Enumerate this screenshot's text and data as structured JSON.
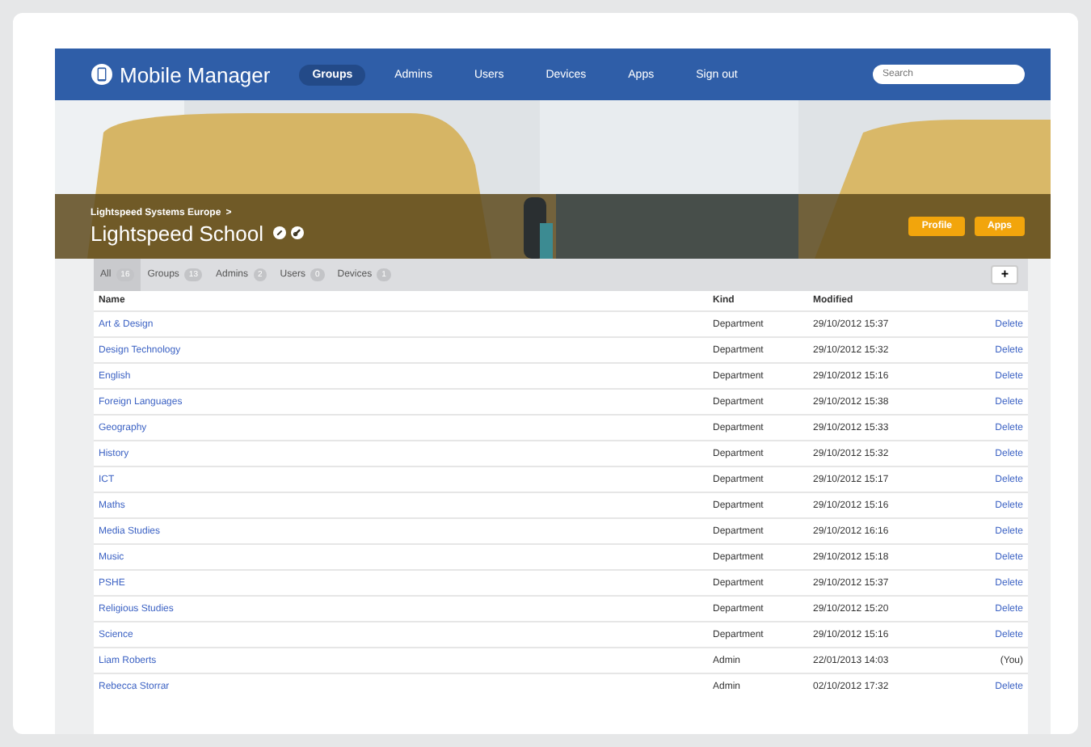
{
  "app": {
    "title": "Mobile Manager"
  },
  "nav": [
    {
      "label": "Groups",
      "selected": true
    },
    {
      "label": "Admins",
      "selected": false
    },
    {
      "label": "Users",
      "selected": false
    },
    {
      "label": "Devices",
      "selected": false
    },
    {
      "label": "Apps",
      "selected": false
    },
    {
      "label": "Sign out",
      "selected": false
    }
  ],
  "search": {
    "placeholder": "Search"
  },
  "banner": {
    "kind": "picture",
    "breadcrumb": "Lightspeed Systems Europe",
    "breadcrumb_sep": ">",
    "title": "Lightspeed School",
    "buttons": [
      "Profile",
      "Apps"
    ]
  },
  "filters": [
    {
      "label": "All",
      "count": "16",
      "selected": true
    },
    {
      "label": "Groups",
      "count": "13",
      "selected": false
    },
    {
      "label": "Admins",
      "count": "2",
      "selected": false
    },
    {
      "label": "Users",
      "count": "0",
      "selected": false
    },
    {
      "label": "Devices",
      "count": "1",
      "selected": false
    }
  ],
  "add_button": "+",
  "table": {
    "columns": [
      "Name",
      "Kind",
      "Modified"
    ],
    "rows": [
      {
        "name": "Art & Design",
        "kind": "Department",
        "modified": "29/10/2012 15:37",
        "action": {
          "kind": "link",
          "label": "Delete"
        }
      },
      {
        "name": "Design Technology",
        "kind": "Department",
        "modified": "29/10/2012 15:32",
        "action": {
          "kind": "link",
          "label": "Delete"
        }
      },
      {
        "name": "English",
        "kind": "Department",
        "modified": "29/10/2012 15:16",
        "action": {
          "kind": "link",
          "label": "Delete"
        }
      },
      {
        "name": "Foreign Languages",
        "kind": "Department",
        "modified": "29/10/2012 15:38",
        "action": {
          "kind": "link",
          "label": "Delete"
        }
      },
      {
        "name": "Geography",
        "kind": "Department",
        "modified": "29/10/2012 15:33",
        "action": {
          "kind": "link",
          "label": "Delete"
        }
      },
      {
        "name": "History",
        "kind": "Department",
        "modified": "29/10/2012 15:32",
        "action": {
          "kind": "link",
          "label": "Delete"
        }
      },
      {
        "name": "ICT",
        "kind": "Department",
        "modified": "29/10/2012 15:17",
        "action": {
          "kind": "link",
          "label": "Delete"
        }
      },
      {
        "name": "Maths",
        "kind": "Department",
        "modified": "29/10/2012 15:16",
        "action": {
          "kind": "link",
          "label": "Delete"
        }
      },
      {
        "name": "Media Studies",
        "kind": "Department",
        "modified": "29/10/2012 16:16",
        "action": {
          "kind": "link",
          "label": "Delete"
        }
      },
      {
        "name": "Music",
        "kind": "Department",
        "modified": "29/10/2012 15:18",
        "action": {
          "kind": "link",
          "label": "Delete"
        }
      },
      {
        "name": "PSHE",
        "kind": "Department",
        "modified": "29/10/2012 15:37",
        "action": {
          "kind": "link",
          "label": "Delete"
        }
      },
      {
        "name": "Religious Studies",
        "kind": "Department",
        "modified": "29/10/2012 15:20",
        "action": {
          "kind": "link",
          "label": "Delete"
        }
      },
      {
        "name": "Science",
        "kind": "Department",
        "modified": "29/10/2012 15:16",
        "action": {
          "kind": "link",
          "label": "Delete"
        }
      },
      {
        "name": "Liam Roberts",
        "kind": "Admin",
        "modified": "22/01/2013 14:03",
        "action": {
          "kind": "note",
          "label": "(You)"
        }
      },
      {
        "name": "Rebecca Storrar",
        "kind": "Admin",
        "modified": "02/10/2012 17:32",
        "action": {
          "kind": "link",
          "label": "Delete"
        }
      }
    ]
  }
}
